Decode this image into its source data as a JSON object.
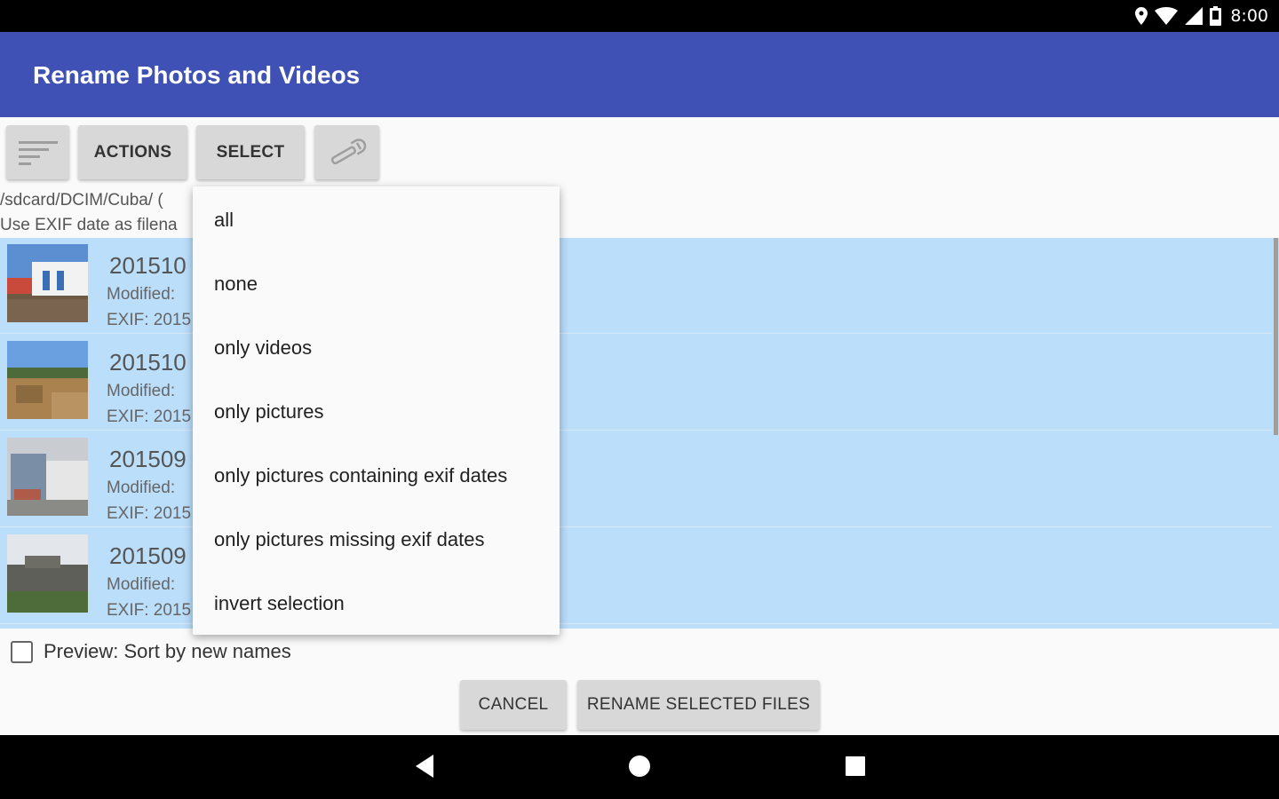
{
  "status": {
    "time": "8:00"
  },
  "app": {
    "title": "Rename Photos and Videos"
  },
  "toolbar": {
    "sort_icon": "sort-lines-icon",
    "actions_label": "ACTIONS",
    "select_label": "SELECT",
    "settings_icon": "wrench-icon"
  },
  "path": {
    "line1": "/sdcard/DCIM/Cuba/ (",
    "line2": "Use EXIF date as filena"
  },
  "files": [
    {
      "name": "201510",
      "modified": "Modified: ",
      "exif": "EXIF: 2015"
    },
    {
      "name": "201510",
      "modified": "Modified: ",
      "exif": "EXIF: 2015"
    },
    {
      "name": "201509",
      "modified": "Modified: ",
      "exif": "EXIF: 2015"
    },
    {
      "name": "201509",
      "modified": "Modified: ",
      "exif": "EXIF: 2015"
    }
  ],
  "select_menu": {
    "items": [
      "all",
      "none",
      "only videos",
      "only pictures",
      "only pictures containing exif dates",
      "only pictures missing exif dates",
      "invert selection"
    ]
  },
  "preview": {
    "label": "Preview: Sort by new names",
    "checked": false
  },
  "footer": {
    "cancel_label": "CANCEL",
    "rename_label": "RENAME SELECTED FILES"
  },
  "colors": {
    "app_bar": "#3f51b5",
    "selected_row": "#bbdefb",
    "button": "#d8d8d8"
  }
}
